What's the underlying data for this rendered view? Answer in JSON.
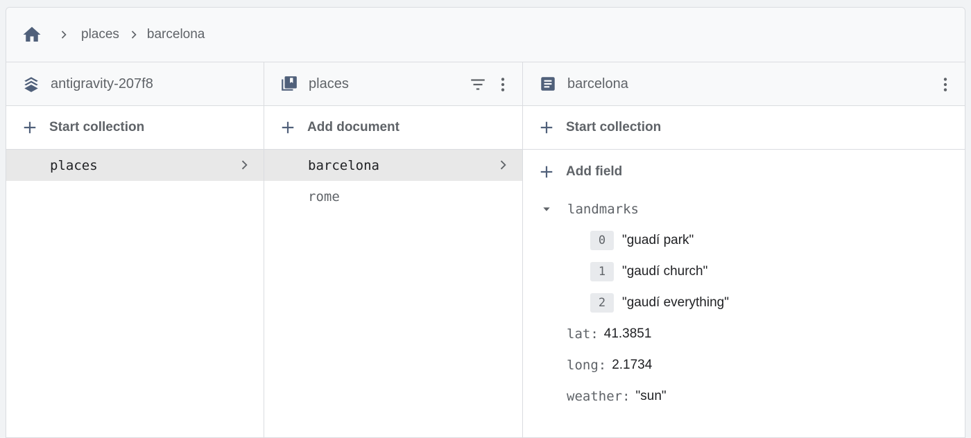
{
  "breadcrumb": {
    "home_icon": "home-icon",
    "items": [
      "places",
      "barcelona"
    ]
  },
  "colors": {
    "icon": "#5f6368",
    "header_bg": "#f8f9fa",
    "selected_bg": "#e8e8e8",
    "border": "#dadce0"
  },
  "project_panel": {
    "icon": "firestore-layers-icon",
    "title": "antigravity-207f8",
    "action_label": "Start collection",
    "items": [
      {
        "label": "places",
        "selected": true
      }
    ]
  },
  "collection_panel": {
    "icon": "collection-icon",
    "title": "places",
    "action_label": "Add document",
    "items": [
      {
        "label": "barcelona",
        "selected": true
      },
      {
        "label": "rome",
        "selected": false
      }
    ]
  },
  "document_panel": {
    "icon": "document-icon",
    "title": "barcelona",
    "start_collection_label": "Start collection",
    "add_field_label": "Add field",
    "landmarks": {
      "key": "landmarks",
      "items": [
        {
          "index": "0",
          "value": "\"guadí park\""
        },
        {
          "index": "1",
          "value": "\"gaudí church\""
        },
        {
          "index": "2",
          "value": "\"gaudí everything\""
        }
      ]
    },
    "fields": [
      {
        "key": "lat:",
        "value": "41.3851"
      },
      {
        "key": "long:",
        "value": "2.1734"
      },
      {
        "key": "weather:",
        "value": "\"sun\""
      }
    ]
  }
}
